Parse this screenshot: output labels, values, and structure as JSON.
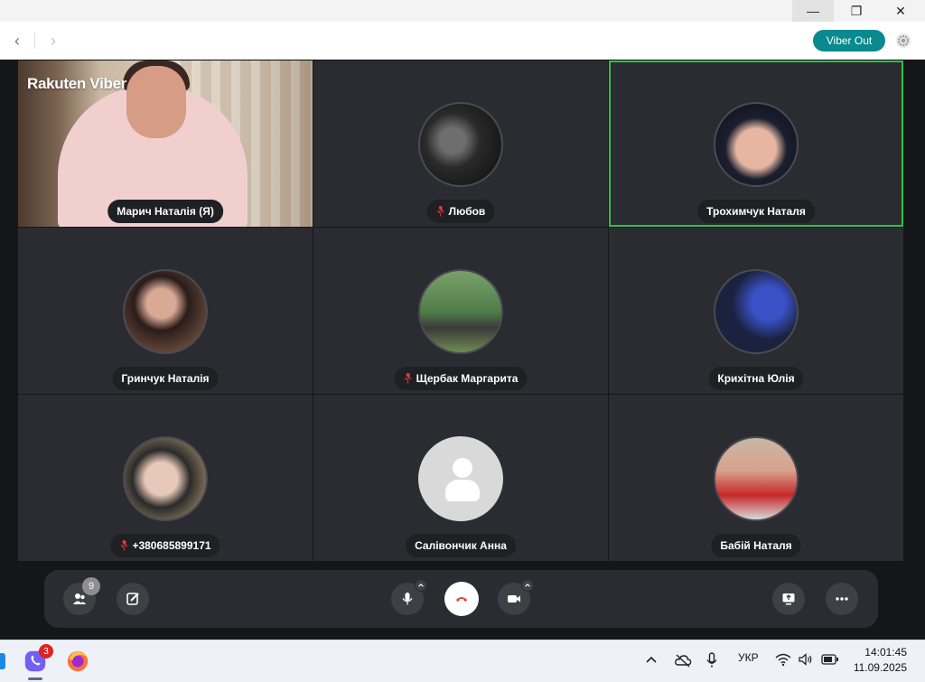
{
  "window": {
    "min_glyph": "—",
    "max_glyph": "❐",
    "close_glyph": "✕"
  },
  "nav": {
    "back_glyph": "‹",
    "forward_glyph": "›",
    "viber_out_label": "Viber Out"
  },
  "self_tile": {
    "brand": "Rakuten Viber",
    "name": "Марич Наталія (Я)"
  },
  "participants": [
    {
      "name": "Любов",
      "muted": true,
      "active": false,
      "avatar": "photo"
    },
    {
      "name": "Трохимчук Наталя",
      "muted": false,
      "active": true,
      "avatar": "photo"
    },
    {
      "name": "Гринчук Наталія",
      "muted": false,
      "active": false,
      "avatar": "photo"
    },
    {
      "name": "Щербак Маргарита",
      "muted": true,
      "active": false,
      "avatar": "photo"
    },
    {
      "name": "Крихітна Юлія",
      "muted": false,
      "active": false,
      "avatar": "photo"
    },
    {
      "name": "+380685899171",
      "muted": true,
      "active": false,
      "avatar": "photo"
    },
    {
      "name": "Салівончик Анна",
      "muted": false,
      "active": false,
      "avatar": "placeholder-person-icon"
    },
    {
      "name": "Бабій Наталя",
      "muted": false,
      "active": false,
      "avatar": "photo"
    }
  ],
  "controls": {
    "participants_count": "9"
  },
  "taskbar": {
    "viber_badge": "3",
    "language": "УКР",
    "time": "14:01:45",
    "date": "11.09.2025"
  },
  "colors": {
    "active_speaker_border": "#32c04a",
    "viber_out_bg": "#0a8a8e",
    "mute_indicator": "#e53935",
    "end_call_icon": "#e53935"
  }
}
